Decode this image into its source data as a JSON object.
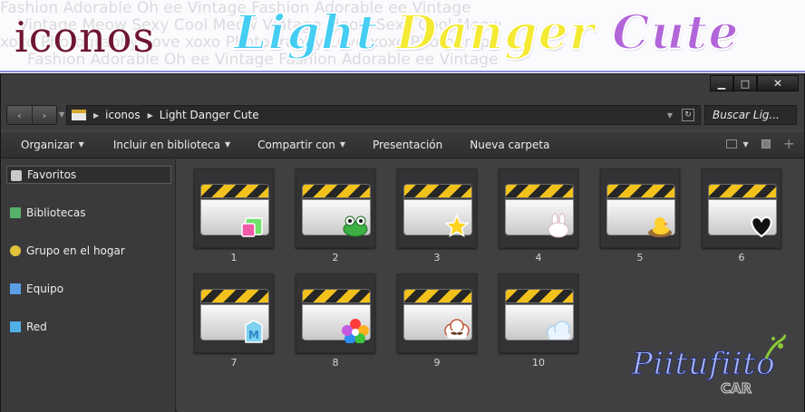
{
  "banner": {
    "title_left": "iconos",
    "title_right": [
      {
        "text": "Light ",
        "color": "#45cdf2"
      },
      {
        "text": "Danger ",
        "color": "#f4ea34"
      },
      {
        "text": "Cute",
        "color": "#b265d8"
      }
    ],
    "bg_rows": [
      "Fashion Adorable Oh ee Vintage Fashion Adorable ee Vintage",
      "Vintage Meow Sexy Cool Meow Vintage Meow Sexy Cool Meow",
      "xoxo Photography Love xoxo Photography Love xoxo Photograph"
    ]
  },
  "window": {
    "controls": {
      "minimize": "▁",
      "maximize": "□",
      "close": "✕"
    }
  },
  "address": {
    "back_icon": "‹",
    "forward_icon": "›",
    "crumbs": [
      "iconos",
      "Light Danger Cute"
    ],
    "search_placeholder": "Buscar Lig..."
  },
  "toolbar": {
    "organize": "Organizar",
    "include": "Incluir en biblioteca",
    "share": "Compartir con",
    "slideshow": "Presentación",
    "new_folder": "Nueva carpeta"
  },
  "nav": [
    {
      "label": "Favoritos",
      "icon": "favorites-icon",
      "color": "#c9c9c9",
      "selected": true
    },
    {
      "label": "Bibliotecas",
      "icon": "libraries-icon",
      "color": "#56b26a"
    },
    {
      "label": "Grupo en el hogar",
      "icon": "homegroup-icon",
      "color": "#e2c23a"
    },
    {
      "label": "Equipo",
      "icon": "computer-icon",
      "color": "#5b9ee6"
    },
    {
      "label": "Red",
      "icon": "network-icon",
      "color": "#4fb0e6"
    }
  ],
  "folders": [
    {
      "label": "1",
      "badge": "gift-icon"
    },
    {
      "label": "2",
      "badge": "frog-icon"
    },
    {
      "label": "3",
      "badge": "star-icon"
    },
    {
      "label": "4",
      "badge": "bunny-icon"
    },
    {
      "label": "5",
      "badge": "duck-icon"
    },
    {
      "label": "6",
      "badge": "heart-icon"
    },
    {
      "label": "7",
      "badge": "milk-carton-icon"
    },
    {
      "label": "8",
      "badge": "flower-icon"
    },
    {
      "label": "9",
      "badge": "mustache-cloud-icon"
    },
    {
      "label": "10",
      "badge": "cloud-icon"
    }
  ],
  "watermark": {
    "name": "Piitufiito",
    "sub": "CAR"
  }
}
